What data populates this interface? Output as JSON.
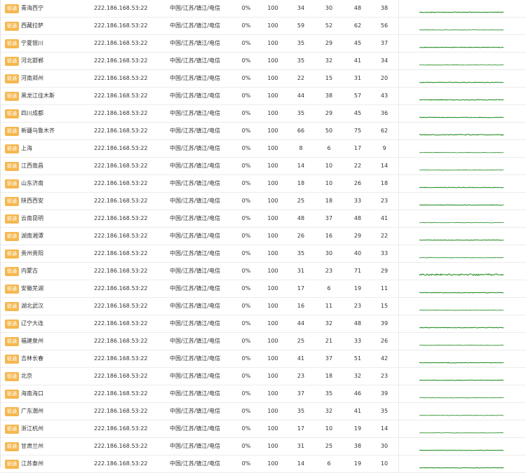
{
  "colors": {
    "badge": "#f5b74f",
    "spark_line": "#1a8a1a"
  },
  "badge_label": "联通",
  "rows": [
    {
      "location": "青海西宁",
      "ip": "222.186.168.53:22",
      "isp": "中国/江苏/镇江/电信",
      "loss": "0%",
      "sent": "100",
      "last": "34",
      "min": "30",
      "max": "48",
      "avg": "38"
    },
    {
      "location": "西藏拉萨",
      "ip": "222.186.168.53:22",
      "isp": "中国/江苏/镇江/电信",
      "loss": "0%",
      "sent": "100",
      "last": "59",
      "min": "52",
      "max": "62",
      "avg": "56"
    },
    {
      "location": "宁夏银川",
      "ip": "222.186.168.53:22",
      "isp": "中国/江苏/镇江/电信",
      "loss": "0%",
      "sent": "100",
      "last": "35",
      "min": "29",
      "max": "45",
      "avg": "37"
    },
    {
      "location": "河北邯郸",
      "ip": "222.186.168.53:22",
      "isp": "中国/江苏/镇江/电信",
      "loss": "0%",
      "sent": "100",
      "last": "35",
      "min": "32",
      "max": "41",
      "avg": "34"
    },
    {
      "location": "河南郑州",
      "ip": "222.186.168.53:22",
      "isp": "中国/江苏/镇江/电信",
      "loss": "0%",
      "sent": "100",
      "last": "22",
      "min": "15",
      "max": "31",
      "avg": "20"
    },
    {
      "location": "黑龙江佳木斯",
      "ip": "222.186.168.53:22",
      "isp": "中国/江苏/镇江/电信",
      "loss": "0%",
      "sent": "100",
      "last": "44",
      "min": "38",
      "max": "57",
      "avg": "43"
    },
    {
      "location": "四川成都",
      "ip": "222.186.168.53:22",
      "isp": "中国/江苏/镇江/电信",
      "loss": "0%",
      "sent": "100",
      "last": "35",
      "min": "29",
      "max": "45",
      "avg": "36"
    },
    {
      "location": "新疆乌鲁木齐",
      "ip": "222.186.168.53:22",
      "isp": "中国/江苏/镇江/电信",
      "loss": "0%",
      "sent": "100",
      "last": "66",
      "min": "50",
      "max": "75",
      "avg": "62"
    },
    {
      "location": "上海",
      "ip": "222.186.168.53:22",
      "isp": "中国/江苏/镇江/电信",
      "loss": "0%",
      "sent": "100",
      "last": "8",
      "min": "6",
      "max": "17",
      "avg": "9"
    },
    {
      "location": "江西南昌",
      "ip": "222.186.168.53:22",
      "isp": "中国/江苏/镇江/电信",
      "loss": "0%",
      "sent": "100",
      "last": "14",
      "min": "10",
      "max": "22",
      "avg": "14"
    },
    {
      "location": "山东济南",
      "ip": "222.186.168.53:22",
      "isp": "中国/江苏/镇江/电信",
      "loss": "0%",
      "sent": "100",
      "last": "18",
      "min": "10",
      "max": "26",
      "avg": "18"
    },
    {
      "location": "陕西西安",
      "ip": "222.186.168.53:22",
      "isp": "中国/江苏/镇江/电信",
      "loss": "0%",
      "sent": "100",
      "last": "25",
      "min": "18",
      "max": "33",
      "avg": "23"
    },
    {
      "location": "云南昆明",
      "ip": "222.186.168.53:22",
      "isp": "中国/江苏/镇江/电信",
      "loss": "0%",
      "sent": "100",
      "last": "48",
      "min": "37",
      "max": "48",
      "avg": "41"
    },
    {
      "location": "湖南湘潭",
      "ip": "222.186.168.53:22",
      "isp": "中国/江苏/镇江/电信",
      "loss": "0%",
      "sent": "100",
      "last": "26",
      "min": "16",
      "max": "29",
      "avg": "22"
    },
    {
      "location": "贵州贵阳",
      "ip": "222.186.168.53:22",
      "isp": "中国/江苏/镇江/电信",
      "loss": "0%",
      "sent": "100",
      "last": "35",
      "min": "30",
      "max": "40",
      "avg": "33"
    },
    {
      "location": "内蒙古",
      "ip": "222.186.168.53:22",
      "isp": "中国/江苏/镇江/电信",
      "loss": "0%",
      "sent": "100",
      "last": "31",
      "min": "23",
      "max": "71",
      "avg": "29"
    },
    {
      "location": "安徽芜湖",
      "ip": "222.186.168.53:22",
      "isp": "中国/江苏/镇江/电信",
      "loss": "0%",
      "sent": "100",
      "last": "17",
      "min": "6",
      "max": "19",
      "avg": "11"
    },
    {
      "location": "湖北武汉",
      "ip": "222.186.168.53:22",
      "isp": "中国/江苏/镇江/电信",
      "loss": "0%",
      "sent": "100",
      "last": "16",
      "min": "11",
      "max": "23",
      "avg": "15"
    },
    {
      "location": "辽宁大连",
      "ip": "222.186.168.53:22",
      "isp": "中国/江苏/镇江/电信",
      "loss": "0%",
      "sent": "100",
      "last": "44",
      "min": "32",
      "max": "48",
      "avg": "39"
    },
    {
      "location": "福建泉州",
      "ip": "222.186.168.53:22",
      "isp": "中国/江苏/镇江/电信",
      "loss": "0%",
      "sent": "100",
      "last": "25",
      "min": "21",
      "max": "33",
      "avg": "26"
    },
    {
      "location": "吉林长春",
      "ip": "222.186.168.53:22",
      "isp": "中国/江苏/镇江/电信",
      "loss": "0%",
      "sent": "100",
      "last": "41",
      "min": "37",
      "max": "51",
      "avg": "42"
    },
    {
      "location": "北京",
      "ip": "222.186.168.53:22",
      "isp": "中国/江苏/镇江/电信",
      "loss": "0%",
      "sent": "100",
      "last": "23",
      "min": "18",
      "max": "32",
      "avg": "23"
    },
    {
      "location": "海南海口",
      "ip": "222.186.168.53:22",
      "isp": "中国/江苏/镇江/电信",
      "loss": "0%",
      "sent": "100",
      "last": "37",
      "min": "35",
      "max": "46",
      "avg": "39"
    },
    {
      "location": "广东潮州",
      "ip": "222.186.168.53:22",
      "isp": "中国/江苏/镇江/电信",
      "loss": "0%",
      "sent": "100",
      "last": "35",
      "min": "32",
      "max": "41",
      "avg": "35"
    },
    {
      "location": "浙江杭州",
      "ip": "222.186.168.53:22",
      "isp": "中国/江苏/镇江/电信",
      "loss": "0%",
      "sent": "100",
      "last": "17",
      "min": "10",
      "max": "19",
      "avg": "14"
    },
    {
      "location": "甘肃兰州",
      "ip": "222.186.168.53:22",
      "isp": "中国/江苏/镇江/电信",
      "loss": "0%",
      "sent": "100",
      "last": "31",
      "min": "25",
      "max": "38",
      "avg": "30"
    },
    {
      "location": "江苏泰州",
      "ip": "222.186.168.53:22",
      "isp": "中国/江苏/镇江/电信",
      "loss": "0%",
      "sent": "100",
      "last": "14",
      "min": "6",
      "max": "19",
      "avg": "10"
    }
  ]
}
